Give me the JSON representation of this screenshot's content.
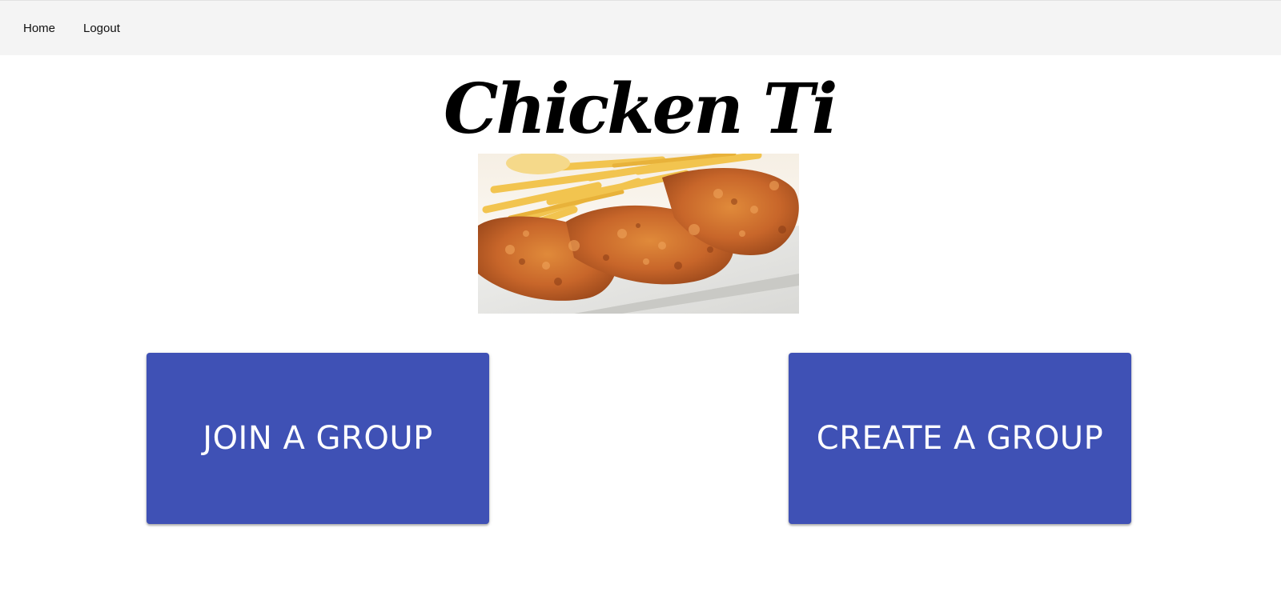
{
  "nav": {
    "home_label": "Home",
    "logout_label": "Logout"
  },
  "logo": {
    "text": "Chicken Tinder"
  },
  "hero_image": {
    "icon": "fried-chicken-and-fries-photo"
  },
  "actions": {
    "join_label": "JOIN A GROUP",
    "create_label": "CREATE A GROUP"
  },
  "colors": {
    "primary": "#3f51b5",
    "navbar_bg": "#f4f4f4",
    "button_text": "#ffffff"
  }
}
